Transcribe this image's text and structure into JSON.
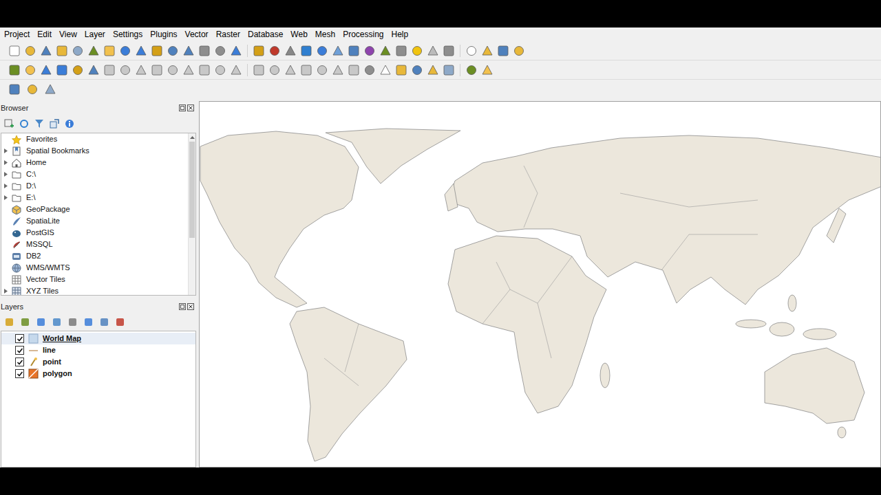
{
  "menu": [
    "Project",
    "Edit",
    "View",
    "Layer",
    "Settings",
    "Plugins",
    "Vector",
    "Raster",
    "Database",
    "Web",
    "Mesh",
    "Processing",
    "Help"
  ],
  "browser": {
    "title": "Browser",
    "items": [
      {
        "label": "Favorites",
        "expandable": false
      },
      {
        "label": "Spatial Bookmarks",
        "expandable": true
      },
      {
        "label": "Home",
        "expandable": true
      },
      {
        "label": "C:\\",
        "expandable": true
      },
      {
        "label": "D:\\",
        "expandable": true
      },
      {
        "label": "E:\\",
        "expandable": true
      },
      {
        "label": "GeoPackage",
        "expandable": false
      },
      {
        "label": "SpatiaLite",
        "expandable": false
      },
      {
        "label": "PostGIS",
        "expandable": false
      },
      {
        "label": "MSSQL",
        "expandable": false
      },
      {
        "label": "DB2",
        "expandable": false
      },
      {
        "label": "WMS/WMTS",
        "expandable": false
      },
      {
        "label": "Vector Tiles",
        "expandable": false
      },
      {
        "label": "XYZ Tiles",
        "expandable": true
      }
    ]
  },
  "layers": {
    "title": "Layers",
    "items": [
      {
        "label": "World Map",
        "checked": true,
        "selected": true
      },
      {
        "label": "line",
        "checked": true,
        "selected": false
      },
      {
        "label": "point",
        "checked": true,
        "selected": false
      },
      {
        "label": "polygon",
        "checked": true,
        "selected": false
      }
    ]
  }
}
